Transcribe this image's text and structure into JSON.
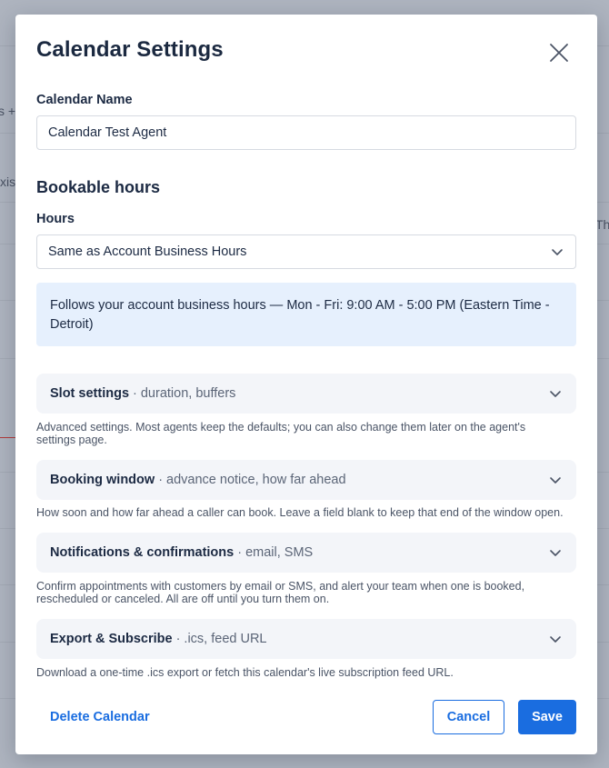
{
  "background": {
    "fragments": [
      "s +",
      "xis",
      "Th"
    ]
  },
  "modal": {
    "title": "Calendar Settings",
    "calendar_name": {
      "label": "Calendar Name",
      "value": "Calendar Test Agent"
    },
    "bookable_hours": {
      "heading": "Bookable hours",
      "hours_label": "Hours",
      "hours_value": "Same as Account Business Hours",
      "info": "Follows your account business hours — Mon - Fri: 9:00 AM - 5:00 PM (Eastern Time - Detroit)"
    },
    "sections": [
      {
        "title": "Slot settings",
        "subtitle": "· duration, buffers",
        "help": "Advanced settings. Most agents keep the defaults; you can also change them later on the agent's settings page."
      },
      {
        "title": "Booking window",
        "subtitle": "· advance notice, how far ahead",
        "help": "How soon and how far ahead a caller can book. Leave a field blank to keep that end of the window open."
      },
      {
        "title": "Notifications & confirmations",
        "subtitle": "· email, SMS",
        "help": "Confirm appointments with customers by email or SMS, and alert your team when one is booked, rescheduled or canceled. All are off until you turn them on."
      },
      {
        "title": "Export & Subscribe",
        "subtitle": "· .ics, feed URL",
        "help": "Download a one-time .ics export or fetch this calendar's live subscription feed URL."
      }
    ],
    "footer": {
      "delete_label": "Delete Calendar",
      "cancel_label": "Cancel",
      "save_label": "Save"
    }
  },
  "colors": {
    "accent": "#1a6de0",
    "info_bg": "#e6f0fd",
    "section_bg": "#f3f5f9"
  },
  "icons": {
    "close": "close-icon",
    "chevron": "chevron-down-icon"
  }
}
